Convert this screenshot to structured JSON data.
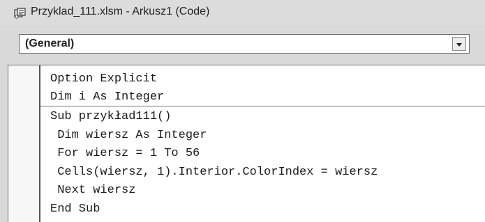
{
  "window": {
    "title": "Przyklad_111.xlsm - Arkusz1 (Code)",
    "icon": "vba-module-icon"
  },
  "object_combo": {
    "selected": "(General)"
  },
  "code": {
    "lines": [
      "Option Explicit",
      "Dim i As Integer",
      "Sub przykład111()",
      " Dim wiersz As Integer",
      " For wiersz = 1 To 56",
      " Cells(wiersz, 1).Interior.ColorIndex = wiersz",
      " Next wiersz",
      "End Sub"
    ]
  }
}
